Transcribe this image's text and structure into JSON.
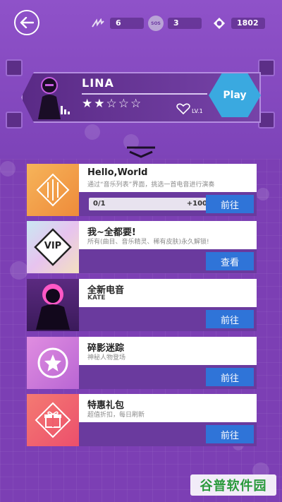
{
  "status": {
    "energy": "6",
    "sos": "3",
    "sos_icon_text": "SOS",
    "coins": "1802"
  },
  "character": {
    "name": "LINA",
    "rating": "★★☆☆☆",
    "level": "LV.1",
    "play_label": "Play"
  },
  "cards": [
    {
      "title": "Hello,World",
      "desc": "通过“音乐列表”界面，挑选一首电音进行演奏",
      "progress": "0/1",
      "reward": "+100",
      "button": "前往",
      "color": "#f2a243"
    },
    {
      "title": "我~全都要!",
      "desc": "所有(曲目、音乐精灵、稀有皮肤)永久解锁!",
      "vip_label": "VIP",
      "button": "查看",
      "color": "#c7b2e8"
    },
    {
      "title": "全新电音",
      "desc": "KATE",
      "button": "前往",
      "color": "#3a1a5a"
    },
    {
      "title": "碎影迷踪",
      "desc": "神秘人物登场",
      "button": "前往",
      "color": "#d07ad8"
    },
    {
      "title": "特惠礼包",
      "desc": "超值折扣，每日刷新",
      "button": "前往",
      "color": "#ef5d6e"
    }
  ],
  "watermark": "谷普软件园"
}
